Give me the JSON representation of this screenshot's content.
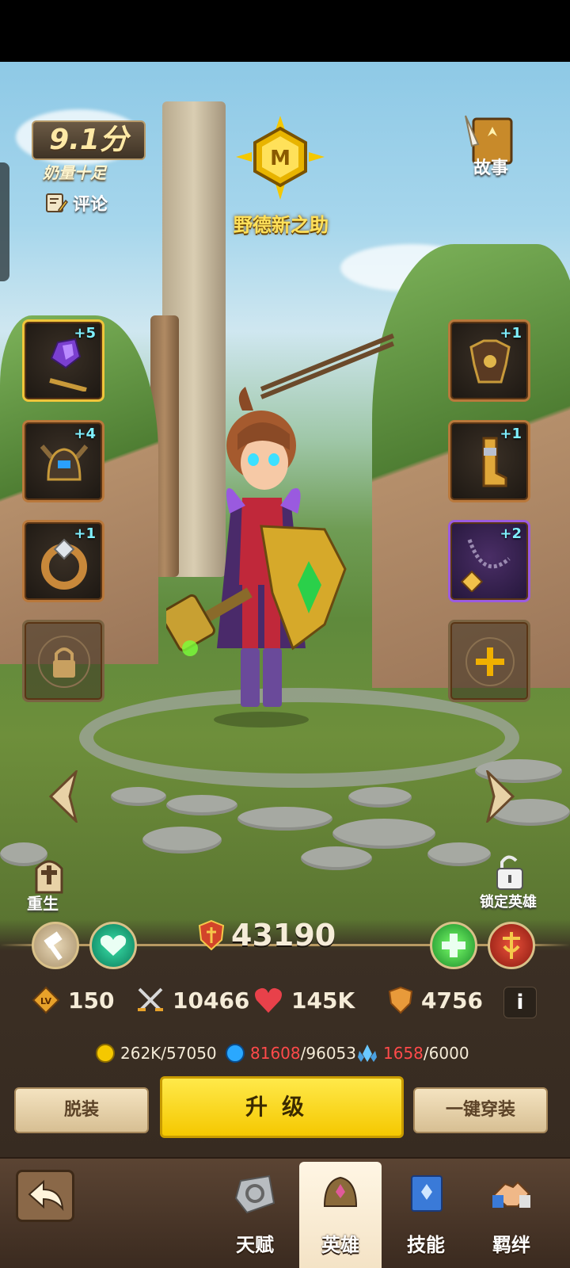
{
  "hero": {
    "rating": "9.1分",
    "rating_desc": "奶量十足",
    "comment_label": "评论",
    "title": "野德新之助",
    "story_label": "故事"
  },
  "equipment": {
    "left": [
      {
        "name": "hammer",
        "level": "+5"
      },
      {
        "name": "helmet",
        "level": "+4"
      },
      {
        "name": "ring",
        "level": "+1"
      }
    ],
    "right": [
      {
        "name": "chest-armor",
        "level": "+1"
      },
      {
        "name": "boots",
        "level": "+1"
      },
      {
        "name": "necklace",
        "level": "+2"
      }
    ]
  },
  "actions": {
    "rebirth_label": "重生",
    "lock_hero_label": "锁定英雄"
  },
  "stats": {
    "power": "43190",
    "level": "150",
    "attack": "10466",
    "hp": "145K",
    "defense": "4756",
    "info": "i"
  },
  "resources": {
    "gold": "262K/57050",
    "exp_current": "81608",
    "exp_total": "/96053",
    "crystal_current": "1658",
    "crystal_total": "/6000"
  },
  "buttons": {
    "unequip": "脱装",
    "upgrade": "升级",
    "one_click_equip": "一键穿装"
  },
  "nav": {
    "tabs": [
      {
        "label": "天赋",
        "active": false
      },
      {
        "label": "英雄",
        "active": true
      },
      {
        "label": "技能",
        "active": false
      },
      {
        "label": "羁绊",
        "active": false
      }
    ]
  },
  "colors": {
    "upgrade_button": "#f5c800",
    "stat_text": "#f5ecd8",
    "red_resource": "#ff4a4a",
    "hero_title": "#ffe15a"
  }
}
